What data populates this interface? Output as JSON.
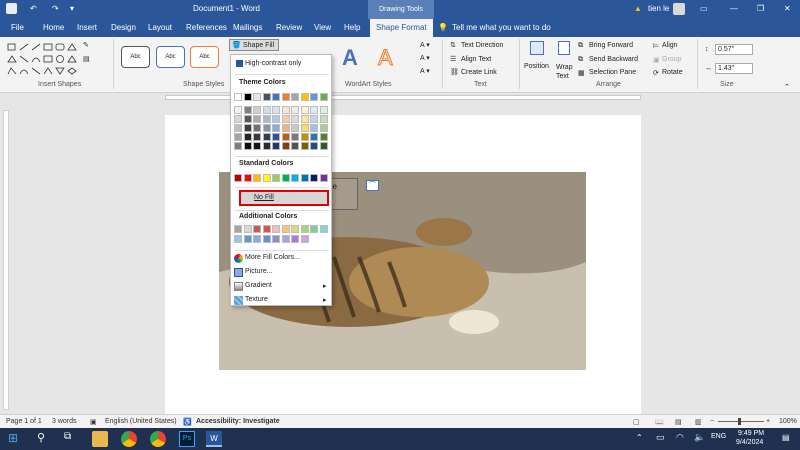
{
  "titlebar": {
    "doc": "Document1 - Word",
    "context": "Drawing Tools",
    "user": "tien le"
  },
  "tabs": [
    "File",
    "Home",
    "Insert",
    "Design",
    "Layout",
    "References",
    "Mailings",
    "Review",
    "View",
    "Help",
    "Shape Format"
  ],
  "tell_me": "Tell me what you want to do",
  "ribbon": {
    "groups": [
      "Insert Shapes",
      "Shape Styles",
      "WordArt Styles",
      "Text",
      "Arrange",
      "Size"
    ],
    "style_label": "Abc",
    "shape_fill": "Shape Fill",
    "text_direction": "Text Direction",
    "align_text": "Align Text",
    "create_link": "Create Link",
    "position": "Position",
    "wrap_text": "Wrap Text",
    "bring_forward": "Bring Forward",
    "send_backward": "Send Backward",
    "selection_pane": "Selection Pane",
    "align": "Align",
    "group": "Group",
    "rotate": "Rotate",
    "height": "0.57\"",
    "width": "1.43\""
  },
  "dropdown": {
    "high_contrast": "High-contrast only",
    "theme_colors": "Theme Colors",
    "standard_colors": "Standard Colors",
    "no_fill": "No Fill",
    "additional_colors": "Additional Colors",
    "more_fill_colors": "More Fill Colors...",
    "picture": "Picture...",
    "gradient": "Gradient",
    "texture": "Texture",
    "theme_top": [
      "#ffffff",
      "#000000",
      "#e7e6e6",
      "#44546a",
      "#4472c4",
      "#ed7d31",
      "#a5a5a5",
      "#ffc000",
      "#5b9bd5",
      "#70ad47"
    ],
    "theme_shades": [
      [
        "#f2f2f2",
        "#808080",
        "#d0cece",
        "#d6dce4",
        "#d9e2f3",
        "#fbe5d5",
        "#ededed",
        "#fff2cc",
        "#deebf6",
        "#e2efd9"
      ],
      [
        "#d8d8d8",
        "#595959",
        "#aeabab",
        "#adb9ca",
        "#b4c6e7",
        "#f7cbac",
        "#dbdbdb",
        "#fee599",
        "#bdd7ee",
        "#c5e0b3"
      ],
      [
        "#bfbfbf",
        "#3f3f3f",
        "#757070",
        "#8496b0",
        "#8eaadb",
        "#f4b183",
        "#c9c9c9",
        "#ffd965",
        "#9cc3e5",
        "#a8d08d"
      ],
      [
        "#a5a5a5",
        "#262626",
        "#3a3838",
        "#323f4f",
        "#2f5496",
        "#c55a11",
        "#7b7b7b",
        "#bf9000",
        "#2e75b5",
        "#538135"
      ],
      [
        "#7f7f7f",
        "#0c0c0c",
        "#171616",
        "#222a35",
        "#1f3864",
        "#833c0b",
        "#525252",
        "#7f6000",
        "#1e4e79",
        "#375623"
      ]
    ],
    "standard": [
      "#c00000",
      "#ff0000",
      "#ffc000",
      "#ffff00",
      "#92d050",
      "#00b050",
      "#00b0f0",
      "#0070c0",
      "#002060",
      "#7030a0"
    ],
    "additional": [
      [
        "#a6a6a6",
        "#d9d9d9",
        "#c9585e",
        "#e04d4d",
        "#f8b9c6",
        "#f9c574",
        "#d6dc7b",
        "#a6d67b",
        "#7ecf9b",
        "#7ed5e0"
      ],
      [
        "#9cc2e5",
        "#5b9bd5",
        "#8eaadb",
        "#6d8fd0",
        "#8a93c8",
        "#a6a6e0",
        "#b07bd5",
        "#cfa2e5"
      ]
    ]
  },
  "textbox_fragment": "ile",
  "status": {
    "page": "Page 1 of 1",
    "words": "3 words",
    "lang": "English (United States)",
    "accessibility": "Accessibility: Investigate",
    "zoom": "100%"
  },
  "taskbar": {
    "time": "9:49 PM",
    "date": "9/4/2024"
  }
}
